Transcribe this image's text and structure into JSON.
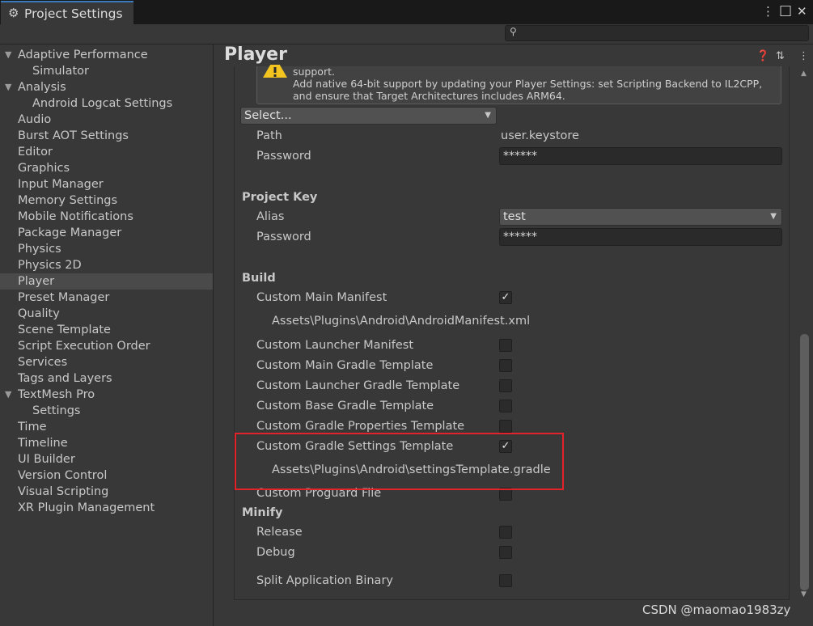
{
  "window": {
    "tab_title": "Project Settings",
    "gear_glyph": "⚙",
    "menu_glyph": "⋮",
    "maximize_glyph": "□",
    "close_glyph": "✕"
  },
  "search": {
    "icon": "search-icon",
    "glyph": "⚲",
    "value": ""
  },
  "sidebar": {
    "items": [
      {
        "label": "Adaptive Performance",
        "expanded": true
      },
      {
        "label": "Simulator"
      },
      {
        "label": "Analysis",
        "expanded": true
      },
      {
        "label": "Android Logcat Settings"
      },
      {
        "label": "Audio"
      },
      {
        "label": "Burst AOT Settings"
      },
      {
        "label": "Editor"
      },
      {
        "label": "Graphics"
      },
      {
        "label": "Input Manager"
      },
      {
        "label": "Memory Settings"
      },
      {
        "label": "Mobile Notifications"
      },
      {
        "label": "Package Manager"
      },
      {
        "label": "Physics"
      },
      {
        "label": "Physics 2D"
      },
      {
        "label": "Player",
        "selected": true
      },
      {
        "label": "Preset Manager"
      },
      {
        "label": "Quality"
      },
      {
        "label": "Scene Template"
      },
      {
        "label": "Script Execution Order"
      },
      {
        "label": "Services"
      },
      {
        "label": "Tags and Layers"
      },
      {
        "label": "TextMesh Pro",
        "expanded": true
      },
      {
        "label": "Settings"
      },
      {
        "label": "Time"
      },
      {
        "label": "Timeline"
      },
      {
        "label": "UI Builder"
      },
      {
        "label": "Version Control"
      },
      {
        "label": "Visual Scripting"
      },
      {
        "label": "XR Plugin Management"
      }
    ]
  },
  "header": {
    "title": "Player",
    "help_glyph": "❓",
    "preset_glyph": "⇅",
    "menu_glyph": "⋮"
  },
  "warning": {
    "line1": "support.",
    "line2": "Add native 64-bit support by updating your Player Settings: set Scripting Backend to IL2CPP,",
    "line3": "and ensure that Target Architectures includes ARM64."
  },
  "keystore": {
    "select_label": "Select...",
    "path_label": "Path",
    "path_value": "user.keystore",
    "password_label": "Password",
    "password_value": "******"
  },
  "project_key": {
    "section": "Project Key",
    "alias_label": "Alias",
    "alias_value": "test",
    "password_label": "Password",
    "password_value": "******"
  },
  "build": {
    "section": "Build",
    "custom_main_manifest": "Custom Main Manifest",
    "manifest_path": "Assets\\Plugins\\Android\\AndroidManifest.xml",
    "custom_launcher_manifest": "Custom Launcher Manifest",
    "custom_main_gradle": "Custom Main Gradle Template",
    "custom_launcher_gradle": "Custom Launcher Gradle Template",
    "custom_base_gradle": "Custom Base Gradle Template",
    "custom_gradle_properties": "Custom Gradle Properties Template",
    "custom_gradle_settings": "Custom Gradle Settings Template",
    "settings_path": "Assets\\Plugins\\Android\\settingsTemplate.gradle",
    "custom_proguard": "Custom Proguard File",
    "check_glyph": "✓"
  },
  "minify": {
    "section": "Minify",
    "release": "Release",
    "debug": "Debug",
    "split_binary": "Split Application Binary"
  },
  "watermark": "CSDN @maomao1983zy",
  "colors": {
    "highlight": "#e3232a",
    "accent": "#3a79bb"
  }
}
